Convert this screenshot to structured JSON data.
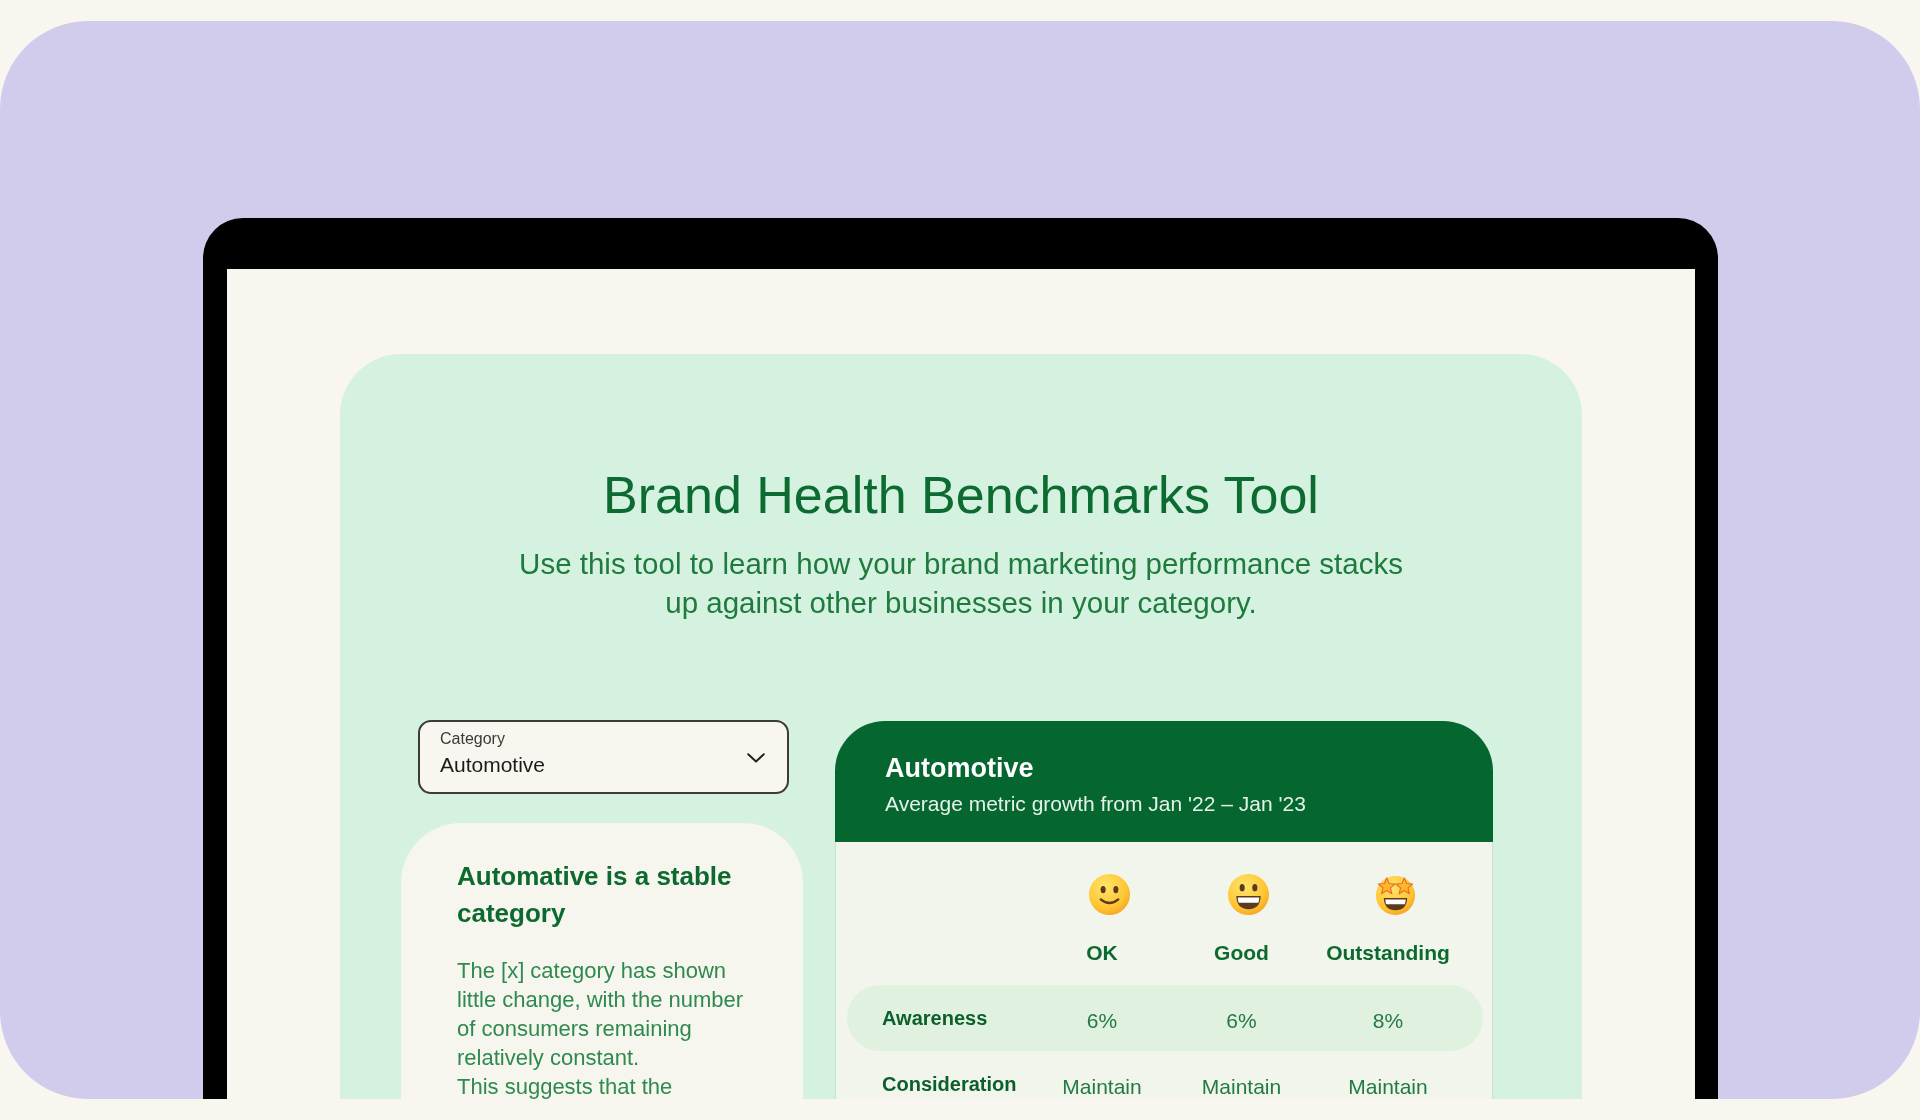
{
  "header": {
    "title": "Brand Health Benchmarks Tool",
    "subtitle": "Use this tool to learn how your brand marketing performance stacks up against other businesses in your category."
  },
  "category_select": {
    "label": "Category",
    "value": "Automotive"
  },
  "summary": {
    "heading": "Automative is a stable category",
    "paragraphs": [
      "The [x] category has shown little change, with the number of consumers remaining relatively constant.",
      "This suggests that the"
    ]
  },
  "benchmarks": {
    "title": "Automotive",
    "subtitle": "Average metric growth from Jan '22 – Jan '23",
    "columns": [
      {
        "label": "OK",
        "kind": "smile"
      },
      {
        "label": "Good",
        "kind": "grin"
      },
      {
        "label": "Outstanding",
        "kind": "starstruck"
      }
    ],
    "rows": [
      {
        "metric": "Awareness",
        "highlighted": true,
        "values": [
          "6%",
          "6%",
          "8%"
        ]
      },
      {
        "metric": "Consideration",
        "highlighted": false,
        "values": [
          "Maintain",
          "Maintain",
          "Maintain"
        ]
      }
    ]
  }
}
